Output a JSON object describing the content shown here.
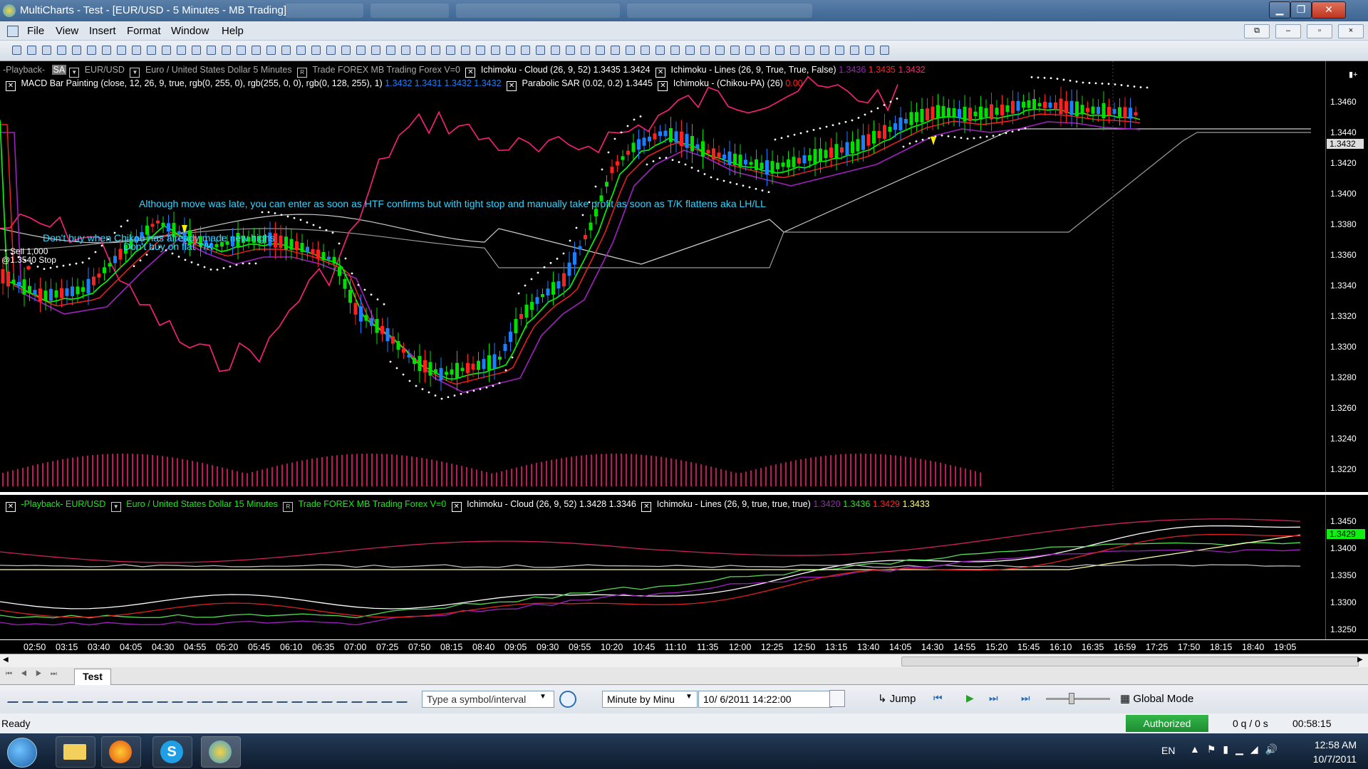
{
  "window": {
    "title": "MultiCharts - Test - [EUR/USD - 5 Minutes - MB Trading]"
  },
  "menu": [
    "File",
    "View",
    "Insert",
    "Format",
    "Window",
    "Help"
  ],
  "pane1": {
    "status1": {
      "playback": "-Playback-",
      "mode": "SA",
      "symbol": "EUR/USD",
      "description": "Euro / United States Dollar  5 Minutes",
      "trade": "Trade  FOREX  MB Trading  Forex  V=0",
      "cloud": "Ichimoku - Cloud  (26,  9,  52)  1.3435  1.3424",
      "lines": "Ichimoku - Lines  (26,  9,  True,  True,  False)",
      "lines_v1": "1.3436",
      "lines_v2": "1.3435",
      "lines_v3": "1.3432"
    },
    "status2": {
      "macd": "MACD Bar Painting  (close,  12,  26,  9,  true,  rgb(0, 255, 0),  rgb(255, 0, 0),  rgb(0, 128, 255),  1)",
      "macd_vals": "1.3432   1.3431   1.3432   1.3432",
      "sar": "Parabolic SAR  (0.02,  0.2)  1.3445",
      "chikou": "Ichimoku - (Chikou-PA)  (26)",
      "chikou_val": "0.00"
    },
    "annotations": {
      "a1": "Although move was late, you can enter as soon as HTF confirms but with tight stop and manually take profit as soon as T/K flattens aka LH/LL",
      "a2": "Don't buy when Chikou has already made new highs",
      "a3": "Don't buy on flat T/K",
      "order1": "Sell 1,000",
      "order2": "@1.3540 Stop"
    },
    "y_ticks": [
      "1.3460",
      "1.3440",
      "1.3420",
      "1.3400",
      "1.3380",
      "1.3360",
      "1.3340",
      "1.3320",
      "1.3300",
      "1.3280",
      "1.3260",
      "1.3240",
      "1.3220"
    ],
    "last_price": "1.3432"
  },
  "pane2": {
    "status": {
      "playback": "-Playback-  EUR/USD",
      "description": "Euro / United States Dollar  15 Minutes",
      "trade": "Trade  FOREX  MB Trading  Forex  V=0",
      "cloud": "Ichimoku - Cloud  (26,  9,  52)  1.3428  1.3346",
      "lines": "Ichimoku - Lines  (26,  9,  true,  true,  true)",
      "v1": "1.3420",
      "v2": "1.3436",
      "v3": "1.3429",
      "v4": "1.3433"
    },
    "y_ticks": [
      "1.3450",
      "1.3400",
      "1.3350",
      "1.3300",
      "1.3250"
    ],
    "last_price": "1.3429"
  },
  "x_ticks": [
    "02:50",
    "03:15",
    "03:40",
    "04:05",
    "04:30",
    "04:55",
    "05:20",
    "05:45",
    "06:10",
    "06:35",
    "07:00",
    "07:25",
    "07:50",
    "08:15",
    "08:40",
    "09:05",
    "09:30",
    "09:55",
    "10:20",
    "10:45",
    "11:10",
    "11:35",
    "12:00",
    "12:25",
    "12:50",
    "13:15",
    "13:40",
    "14:05",
    "14:30",
    "14:55",
    "15:20",
    "15:45",
    "16:10",
    "16:35",
    "16:59",
    "17:25",
    "17:50",
    "18:15",
    "18:40",
    "19:05"
  ],
  "tab": "Test",
  "bottombar": {
    "symbol_placeholder": "Type a symbol/interval",
    "resolution": "Minute by Minu",
    "datetime": "10/  6/2011 14:22:00",
    "jump": "Jump",
    "global_mode": "Global Mode"
  },
  "status": {
    "ready": "Ready",
    "authorized": "Authorized",
    "queue": "0 q / 0 s",
    "timer": "00:58:15"
  },
  "taskbar": {
    "lang": "EN",
    "time": "12:58 AM",
    "date": "10/7/2011"
  },
  "colors": {
    "tenkan": "#00ff00",
    "kijun": "#ff2020",
    "chikou": "#ff1f7a",
    "senkou": "#cccccc",
    "purple": "#a020c0",
    "bull": "#00e000",
    "bear": "#ff2020",
    "neutral": "#1a80ff",
    "annotation": "#33d4ff"
  }
}
